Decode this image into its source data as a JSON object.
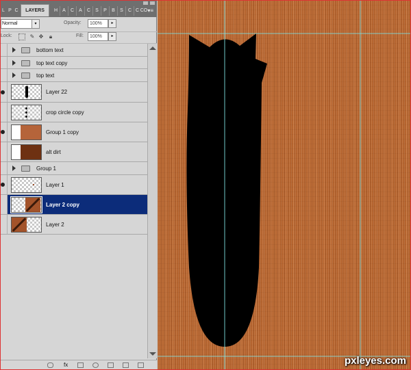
{
  "panel": {
    "tabs": [
      "L",
      "P",
      "C",
      "LAYERS",
      "H",
      "A",
      "C",
      "A",
      "C",
      "S",
      "P",
      "B",
      "S",
      "C",
      "C",
      "CO"
    ],
    "active_tab": "LAYERS",
    "menu_icon": "panel-menu-icon",
    "blend_mode": "Normal",
    "opacity_label": "Opacity:",
    "opacity_value": "100%",
    "lock_label": "Lock:",
    "fill_label": "Fill:",
    "fill_value": "100%"
  },
  "layers": [
    {
      "name": "bottom text",
      "kind": "group",
      "visible": false
    },
    {
      "name": "top text copy",
      "kind": "group",
      "visible": false
    },
    {
      "name": "top text",
      "kind": "group",
      "visible": false
    },
    {
      "name": "Layer 22",
      "kind": "layer",
      "visible": true,
      "thumb": "black-shape"
    },
    {
      "name": "crop circle copy",
      "kind": "layer",
      "visible": false,
      "thumb": "dots"
    },
    {
      "name": "Group 1 copy",
      "kind": "layer",
      "visible": true,
      "thumb": "solid",
      "thumb_color": "#b5643a"
    },
    {
      "name": "alt dirt",
      "kind": "layer",
      "visible": false,
      "thumb": "solid",
      "thumb_color": "#6e3112"
    },
    {
      "name": "Group 1",
      "kind": "group",
      "visible": false
    },
    {
      "name": "Layer 1",
      "kind": "layer",
      "visible": true,
      "thumb": "speck"
    },
    {
      "name": "Layer 2 copy",
      "kind": "layer",
      "visible": false,
      "selected": true,
      "thumb": "wood-diagonal"
    },
    {
      "name": "Layer 2",
      "kind": "layer",
      "visible": false,
      "thumb": "wood-diagonal"
    }
  ],
  "canvas": {
    "watermark": "pxleyes.com",
    "background_color": "#b5642f",
    "shape_color": "#000000",
    "guide_color": "#7fe0e0"
  }
}
